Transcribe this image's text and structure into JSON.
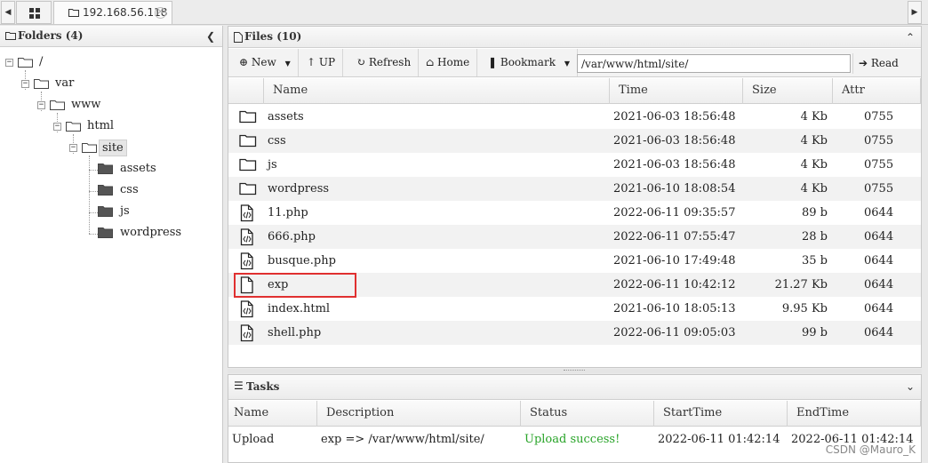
{
  "tabs": {
    "left_arrow": "◀",
    "right_arrow": "▶",
    "active_tab": "192.168.56.118",
    "close_symbol": "✕"
  },
  "folders_panel": {
    "title": "Folders (4)",
    "collapse_symbol": "❮",
    "tree": [
      {
        "label": "/",
        "toggle": "−"
      },
      {
        "label": "var",
        "toggle": "−"
      },
      {
        "label": "www",
        "toggle": "−"
      },
      {
        "label": "html",
        "toggle": "−"
      },
      {
        "label": "site",
        "toggle": "−",
        "selected": true
      },
      {
        "label": "assets"
      },
      {
        "label": "css"
      },
      {
        "label": "js"
      },
      {
        "label": "wordpress"
      }
    ]
  },
  "files_panel": {
    "title": "Files (10)",
    "collapse_symbol": "⌃",
    "toolbar": {
      "new_label": "New",
      "up_label": "UP",
      "refresh_label": "Refresh",
      "home_label": "Home",
      "bookmark_label": "Bookmark",
      "path_value": "/var/www/html/site/",
      "read_label": "Read"
    },
    "columns": [
      "Name",
      "Time",
      "Size",
      "Attr"
    ],
    "rows": [
      {
        "icon": "folder-icon",
        "name": "assets",
        "time": "2021-06-03 18:56:48",
        "size": "4 Kb",
        "attr": "0755"
      },
      {
        "icon": "folder-icon",
        "name": "css",
        "time": "2021-06-03 18:56:48",
        "size": "4 Kb",
        "attr": "0755"
      },
      {
        "icon": "folder-icon",
        "name": "js",
        "time": "2021-06-03 18:56:48",
        "size": "4 Kb",
        "attr": "0755"
      },
      {
        "icon": "folder-icon",
        "name": "wordpress",
        "time": "2021-06-10 18:08:54",
        "size": "4 Kb",
        "attr": "0755"
      },
      {
        "icon": "code-file-icon",
        "name": "11.php",
        "time": "2022-06-11 09:35:57",
        "size": "89 b",
        "attr": "0644"
      },
      {
        "icon": "code-file-icon",
        "name": "666.php",
        "time": "2022-06-11 07:55:47",
        "size": "28 b",
        "attr": "0644"
      },
      {
        "icon": "code-file-icon",
        "name": "busque.php",
        "time": "2021-06-10 17:49:48",
        "size": "35 b",
        "attr": "0644"
      },
      {
        "icon": "file-icon",
        "name": "exp",
        "time": "2022-06-11 10:42:12",
        "size": "21.27 Kb",
        "attr": "0644"
      },
      {
        "icon": "code-file-icon",
        "name": "index.html",
        "time": "2021-06-10 18:05:13",
        "size": "9.95 Kb",
        "attr": "0644"
      },
      {
        "icon": "code-file-icon",
        "name": "shell.php",
        "time": "2022-06-11 09:05:03",
        "size": "99 b",
        "attr": "0644"
      }
    ]
  },
  "tasks_panel": {
    "title": "Tasks",
    "collapse_symbol": "⌄",
    "columns": [
      "Name",
      "Description",
      "Status",
      "StartTime",
      "EndTime"
    ],
    "row": {
      "name": "Upload",
      "description": "exp => /var/www/html/site/",
      "status": "Upload success!",
      "start": "2022-06-11 01:42:14",
      "end": "2022-06-11 01:42:14"
    }
  },
  "watermark": "CSDN @Mauro_K",
  "colors": {
    "success": "#27a327",
    "highlight": "#e03030"
  }
}
